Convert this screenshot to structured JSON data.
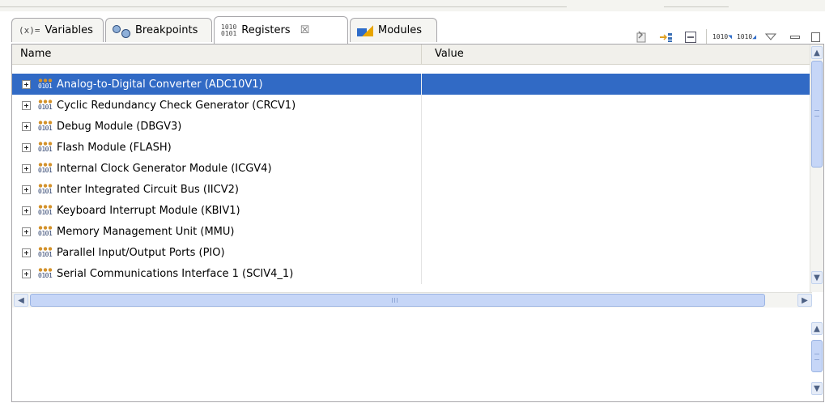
{
  "tabs": [
    {
      "label": "Variables",
      "icon": "variables-icon",
      "icon_text": "(x)="
    },
    {
      "label": "Breakpoints",
      "icon": "breakpoints-icon"
    },
    {
      "label": "Registers",
      "icon": "registers-icon",
      "icon_text": "1010 0101",
      "active": true,
      "close": "☒"
    },
    {
      "label": "Modules",
      "icon": "modules-icon"
    }
  ],
  "toolbar": {
    "icons": [
      "load-register-icon",
      "follow-icon",
      "collapse-all-icon",
      "binary-format-down-icon",
      "binary-format-icon",
      "view-menu-icon",
      "minimize-icon",
      "maximize-icon"
    ],
    "bin_text": "1010"
  },
  "table": {
    "columns": [
      "Name",
      "Value"
    ],
    "rows": [
      {
        "name": "Analog-to-Digital Converter (ADC10V1)",
        "value": "",
        "selected": true
      },
      {
        "name": "Cyclic Redundancy Check Generator (CRCV1)",
        "value": ""
      },
      {
        "name": "Debug Module (DBGV3)",
        "value": ""
      },
      {
        "name": "Flash Module (FLASH)",
        "value": ""
      },
      {
        "name": "Internal Clock Generator Module (ICGV4)",
        "value": ""
      },
      {
        "name": "Inter Integrated Circuit Bus (IICV2)",
        "value": ""
      },
      {
        "name": "Keyboard Interrupt Module (KBIV1)",
        "value": ""
      },
      {
        "name": "Memory Management Unit (MMU)",
        "value": ""
      },
      {
        "name": "Parallel Input/Output Ports (PIO)",
        "value": ""
      },
      {
        "name": "Serial Communications Interface 1 (SCIV4_1)",
        "value": ""
      }
    ],
    "register_icon_text": "0101"
  },
  "colors": {
    "selection": "#316ac5",
    "header_bg": "#f1f0eb",
    "border": "#a7a6aa"
  }
}
